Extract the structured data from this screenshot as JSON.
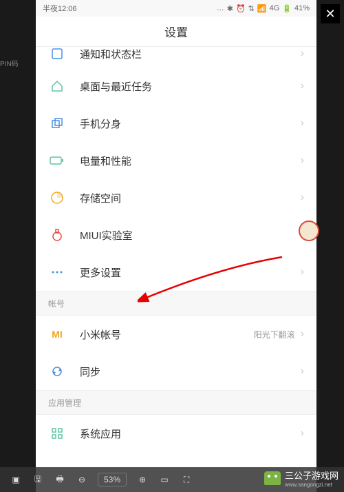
{
  "status": {
    "time": "半夜12:06",
    "network": "4G",
    "battery": "41%"
  },
  "header": {
    "title": "设置"
  },
  "rows": [
    {
      "label": "通知和状态栏",
      "icon": "notification",
      "color": "#4a90e2"
    },
    {
      "label": "桌面与最近任务",
      "icon": "home",
      "color": "#5ec6a0"
    },
    {
      "label": "手机分身",
      "icon": "copy",
      "color": "#4a90e2"
    },
    {
      "label": "电量和性能",
      "icon": "battery",
      "color": "#5ec6a0"
    },
    {
      "label": "存储空间",
      "icon": "storage",
      "color": "#f5a623"
    },
    {
      "label": "MIUI实验室",
      "icon": "lab",
      "color": "#e74c3c"
    },
    {
      "label": "更多设置",
      "icon": "dots",
      "color": "#4a90e2"
    }
  ],
  "section_account": "帐号",
  "account_rows": [
    {
      "label": "小米帐号",
      "value": "阳光下翻滚",
      "icon": "mi",
      "color": "#f5a623"
    },
    {
      "label": "同步",
      "value": "",
      "icon": "sync",
      "color": "#4a90e2"
    }
  ],
  "section_app": "应用管理",
  "app_rows": [
    {
      "label": "系统应用",
      "icon": "grid",
      "color": "#5ec6a0"
    }
  ],
  "toolbar": {
    "zoom": "53%"
  },
  "brand": {
    "name": "三公子游戏网",
    "url": "www.sangongzi.net"
  },
  "bg_left_text": "PIN码"
}
